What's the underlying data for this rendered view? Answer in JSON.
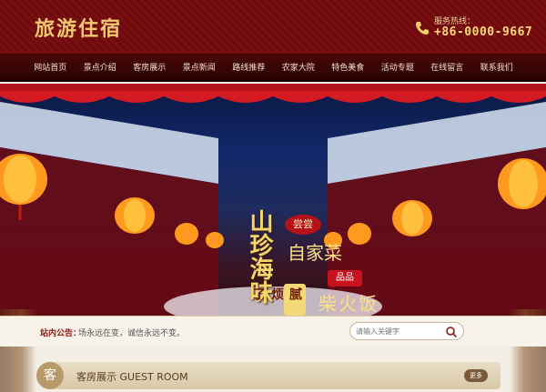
{
  "site": {
    "logo": "旅游住宿",
    "hotline_label": "服务热线：",
    "hotline_number": "+86-0000-9667"
  },
  "nav": {
    "items": [
      "网站首页",
      "景点介绍",
      "客房展示",
      "景点新闻",
      "路线推荐",
      "农家大院",
      "特色美食",
      "活动专题",
      "在线留言",
      "联系我们"
    ]
  },
  "banner": {
    "shanzhen": "山珍海味",
    "chang": "尝尝",
    "zijiacai": "自家菜",
    "pinpin": "品品",
    "chaihuo": "柴火饭",
    "nifanle": "腻烦了"
  },
  "notice": {
    "label": "站内公告：",
    "text": "场永远在变，诚信永远不变。",
    "search_placeholder": "请输入关键字"
  },
  "section": {
    "badge": "客",
    "title": "客房展示 GUEST ROOM",
    "more": "更多"
  },
  "colors": {
    "header_bg": "#7a0f12",
    "nav_bg": "#2a0203",
    "gold": "#f0c870",
    "accent_red": "#b3121a"
  }
}
